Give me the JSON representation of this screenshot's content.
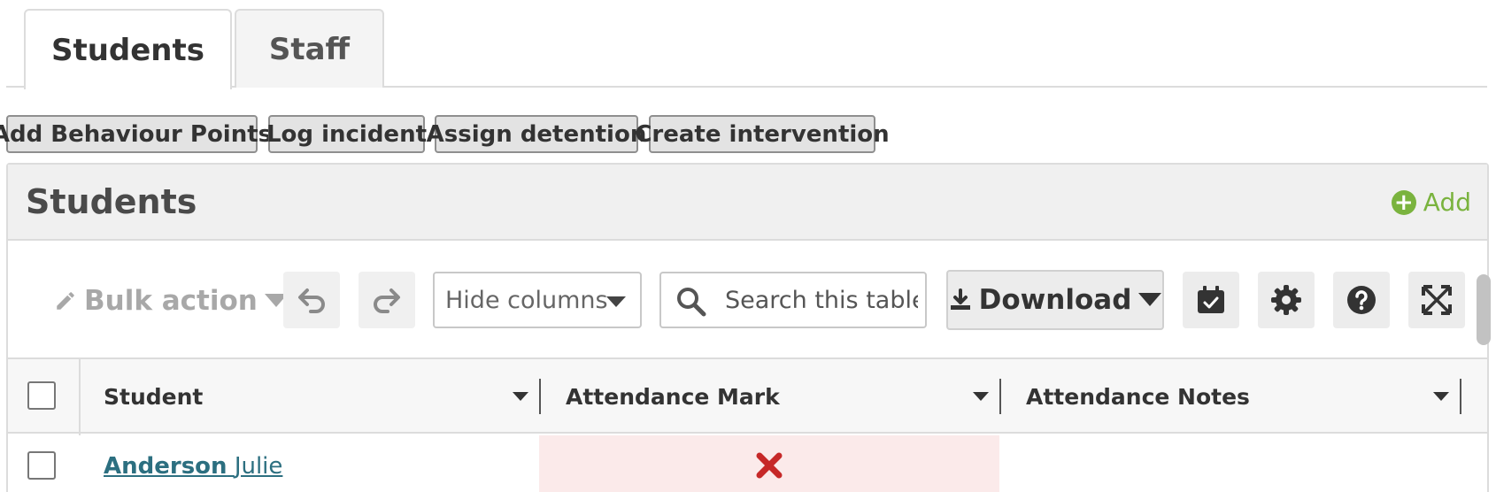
{
  "tabs": [
    {
      "label": "Students",
      "active": true
    },
    {
      "label": "Staff",
      "active": false
    }
  ],
  "actions": [
    {
      "label": "Add Behaviour Points"
    },
    {
      "label": "Log incident"
    },
    {
      "label": "Assign detention"
    },
    {
      "label": "Create intervention"
    }
  ],
  "panel": {
    "title": "Students",
    "add_label": "Add"
  },
  "toolbar": {
    "bulk_action_label": "Bulk action",
    "hide_columns_label": "Hide columns",
    "search_placeholder": "Search this table",
    "download_label": "Download"
  },
  "table": {
    "columns": [
      "Student",
      "Attendance Mark",
      "Attendance Notes"
    ],
    "rows": [
      {
        "last_name": "Anderson",
        "first_name": "Julie",
        "attendance_mark": "absent",
        "notes": ""
      }
    ]
  },
  "colors": {
    "accent_green": "#7ab33e",
    "link_teal": "#2c6f80",
    "absent_red": "#c62828",
    "absent_bg": "#fbeaea"
  },
  "icons": [
    "pencil-icon",
    "undo-icon",
    "redo-icon",
    "search-icon",
    "download-icon",
    "calendar-check-icon",
    "gear-icon",
    "question-icon",
    "expand-icon",
    "cross-icon",
    "plus-circle-icon"
  ]
}
